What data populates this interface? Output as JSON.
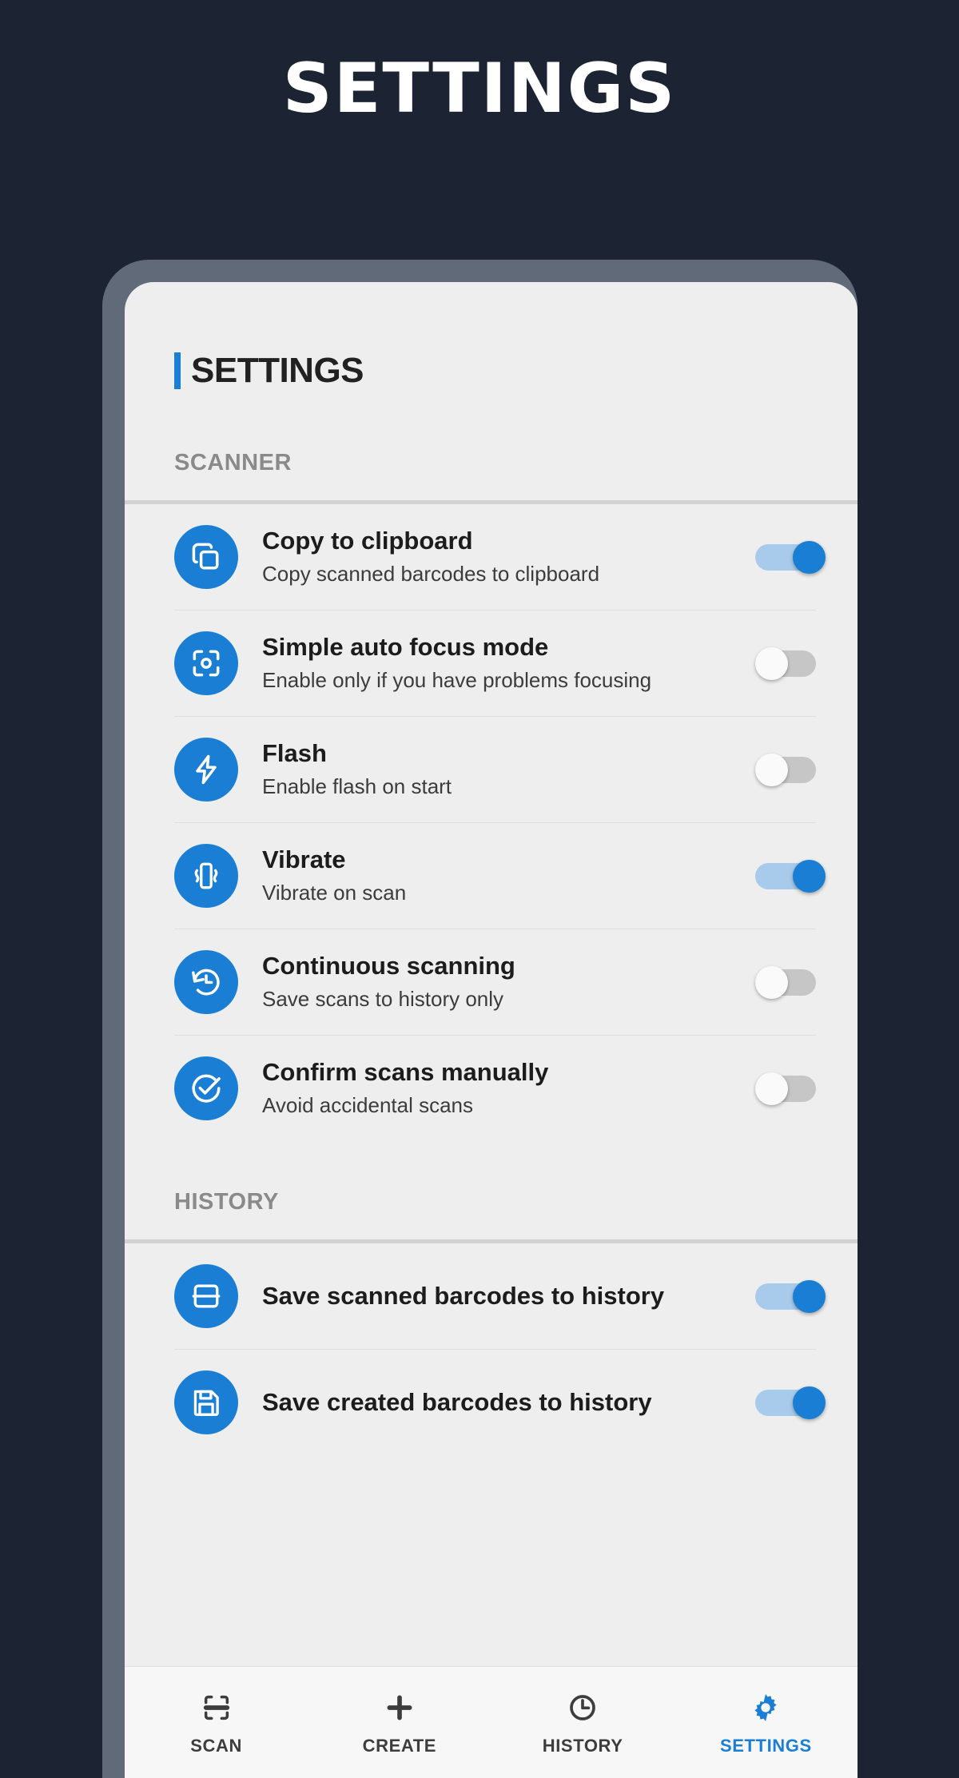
{
  "promo": {
    "title": "SETTINGS"
  },
  "app": {
    "header_title": "SETTINGS",
    "accent_color": "#1a7fd4",
    "screen_bg": "#eeeeee",
    "page_bg": "#1c2433"
  },
  "sections": [
    {
      "label": "SCANNER",
      "rows": [
        {
          "icon": "copy-icon",
          "title": "Copy to clipboard",
          "subtitle": "Copy scanned barcodes to clipboard",
          "toggle": "on"
        },
        {
          "icon": "center-focus-icon",
          "title": "Simple auto focus mode",
          "subtitle": "Enable only if you have problems focusing",
          "toggle": "off"
        },
        {
          "icon": "flash-icon",
          "title": "Flash",
          "subtitle": "Enable flash on start",
          "toggle": "off"
        },
        {
          "icon": "vibrate-icon",
          "title": "Vibrate",
          "subtitle": "Vibrate on scan",
          "toggle": "on"
        },
        {
          "icon": "history-restore-icon",
          "title": "Continuous scanning",
          "subtitle": "Save scans to history only",
          "toggle": "off"
        },
        {
          "icon": "check-circle-icon",
          "title": "Confirm scans manually",
          "subtitle": "Avoid accidental scans",
          "toggle": "off"
        }
      ]
    },
    {
      "label": "HISTORY",
      "rows": [
        {
          "icon": "barcode-archive-icon",
          "title": "Save scanned barcodes to history",
          "subtitle": "",
          "toggle": "on"
        },
        {
          "icon": "floppy-save-icon",
          "title": "Save created barcodes to history",
          "subtitle": "",
          "toggle": "on"
        }
      ]
    }
  ],
  "bottom_nav": {
    "items": [
      {
        "icon": "barcode-scan-icon",
        "label": "SCAN",
        "active": false
      },
      {
        "icon": "plus-icon",
        "label": "CREATE",
        "active": false
      },
      {
        "icon": "clock-icon",
        "label": "HISTORY",
        "active": false
      },
      {
        "icon": "gear-icon",
        "label": "SETTINGS",
        "active": true
      }
    ]
  }
}
